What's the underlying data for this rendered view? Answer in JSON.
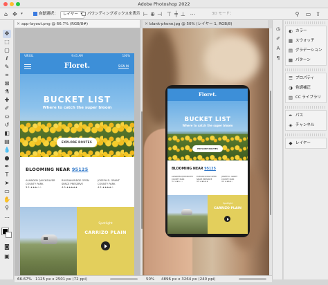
{
  "window": {
    "title": "Adobe Photoshop 2022"
  },
  "options_bar": {
    "auto_select_label": "自動選択：",
    "auto_select_value": "レイヤー",
    "bounding_box_label": "バウンディングボックスを表示",
    "mode_3d_label": "3D モード："
  },
  "tabs": [
    {
      "label": "app-layout.png @ 66.7% (RGB/8#)"
    },
    {
      "label": "blank-phone.jpg @ 50% (レイヤー 1, RGB/8)"
    }
  ],
  "status": [
    {
      "zoom": "66.67%",
      "info": "1125 px x 2501 px (72 ppi)"
    },
    {
      "zoom": "50%",
      "info": "4896 px x 3264 px (240 ppi)"
    }
  ],
  "app_mockup": {
    "carrier": "VIRGIL",
    "time": "9:41 AM",
    "battery": "100%",
    "brand": "Floret.",
    "sign_in": "SIGN IN",
    "hero_title": "BUCKET LIST",
    "hero_subtitle": "Where to catch the super bloom",
    "hero_button": "EXPLORE ROUTES",
    "blooming_label": "BLOOMING NEAR",
    "blooming_zip": "95125",
    "locations": [
      {
        "name": "ALMADEN QUICKSILVER COUNTY PARK",
        "rating": "3.2 ★★★☆☆"
      },
      {
        "name": "RUSSIAN RIDGE OPEN SPACE PRESERVE",
        "rating": "4.9 ★★★★★"
      },
      {
        "name": "JOSEPH D. GRANT COUNTY PARK",
        "rating": "4.2 ★★★★☆"
      }
    ],
    "spotlight_label": "Spotlight",
    "spotlight_title": "CARRIZO PLAIN"
  },
  "panels": {
    "group1": [
      {
        "icon": "color-icon",
        "label": "カラー"
      },
      {
        "icon": "swatches-icon",
        "label": "スウォッチ"
      },
      {
        "icon": "gradients-icon",
        "label": "グラデーション"
      },
      {
        "icon": "patterns-icon",
        "label": "パターン"
      }
    ],
    "group2": [
      {
        "icon": "properties-icon",
        "label": "プロパティ"
      },
      {
        "icon": "adjustments-icon",
        "label": "色調補正"
      },
      {
        "icon": "libraries-icon",
        "label": "CC ライブラリ"
      }
    ],
    "group3": [
      {
        "icon": "paths-icon",
        "label": "パス"
      },
      {
        "icon": "channels-icon",
        "label": "チャンネル"
      }
    ],
    "group4": [
      {
        "icon": "layers-icon",
        "label": "レイヤー"
      }
    ]
  },
  "colors": {
    "brand_blue": "#3d8fd8",
    "spotlight_yellow": "#e3cf5c",
    "foreground": "#000000",
    "background": "#ffffff"
  }
}
